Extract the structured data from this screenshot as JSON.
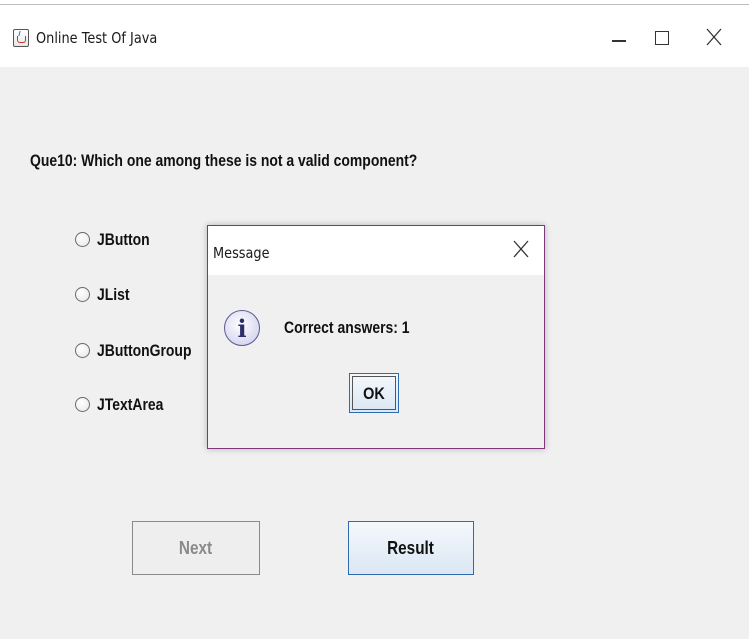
{
  "window": {
    "title": "Online Test Of Java",
    "app_icon": "java-cup-icon",
    "controls": [
      "minimize-icon",
      "maximize-icon",
      "close-icon"
    ]
  },
  "question": {
    "text": "Que10: Which one among these is not a valid component?",
    "options": [
      "JButton",
      "JList",
      "JButtonGroup",
      "JTextArea"
    ],
    "selected": null
  },
  "buttons": {
    "next_label": "Next",
    "next_enabled": false,
    "result_label": "Result"
  },
  "dialog": {
    "title": "Message",
    "icon": "information-icon",
    "icon_glyph": "i",
    "message": "Correct answers: 1",
    "ok_label": "OK"
  },
  "colors": {
    "dialog_border": "#7b3a7e",
    "focus_border": "#2d6cb0",
    "background": "#f0f0f0"
  }
}
